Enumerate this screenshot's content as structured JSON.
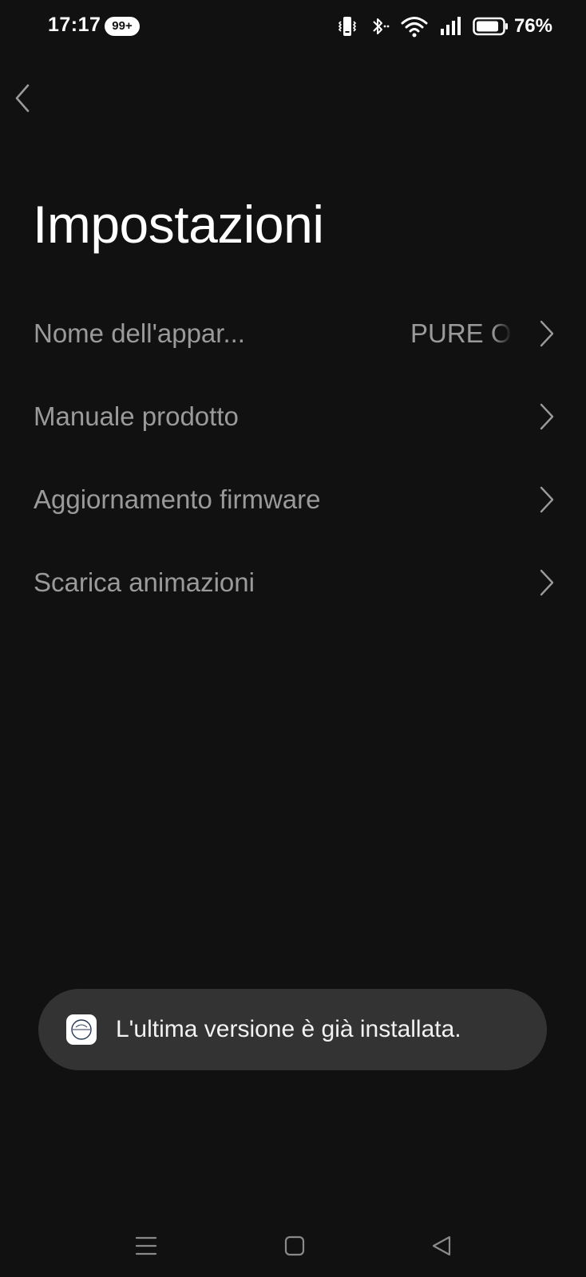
{
  "status_bar": {
    "time": "17:17",
    "notification_badge": "99+",
    "battery_percent": "76%",
    "icons": [
      "vibrate-icon",
      "bluetooth-icon",
      "wifi-icon",
      "signal-icon",
      "battery-icon"
    ]
  },
  "header": {
    "back_icon": "chevron-left-icon",
    "title": "Impostazioni"
  },
  "settings": {
    "items": [
      {
        "label": "Nome dell'appar...",
        "value": "PURE O"
      },
      {
        "label": "Manuale prodotto"
      },
      {
        "label": "Aggiornamento firmware"
      },
      {
        "label": "Scarica animazioni"
      }
    ],
    "chevron_icon": "chevron-right-icon"
  },
  "toast": {
    "app_icon": "tineco-logo-icon",
    "message": "L'ultima versione è già installata."
  },
  "nav_bar": {
    "icons": [
      "menu-icon",
      "home-icon",
      "back-triangle-icon"
    ]
  },
  "colors": {
    "background": "#111111",
    "item_text": "#9a9a9a",
    "toast_background": "#333333"
  }
}
